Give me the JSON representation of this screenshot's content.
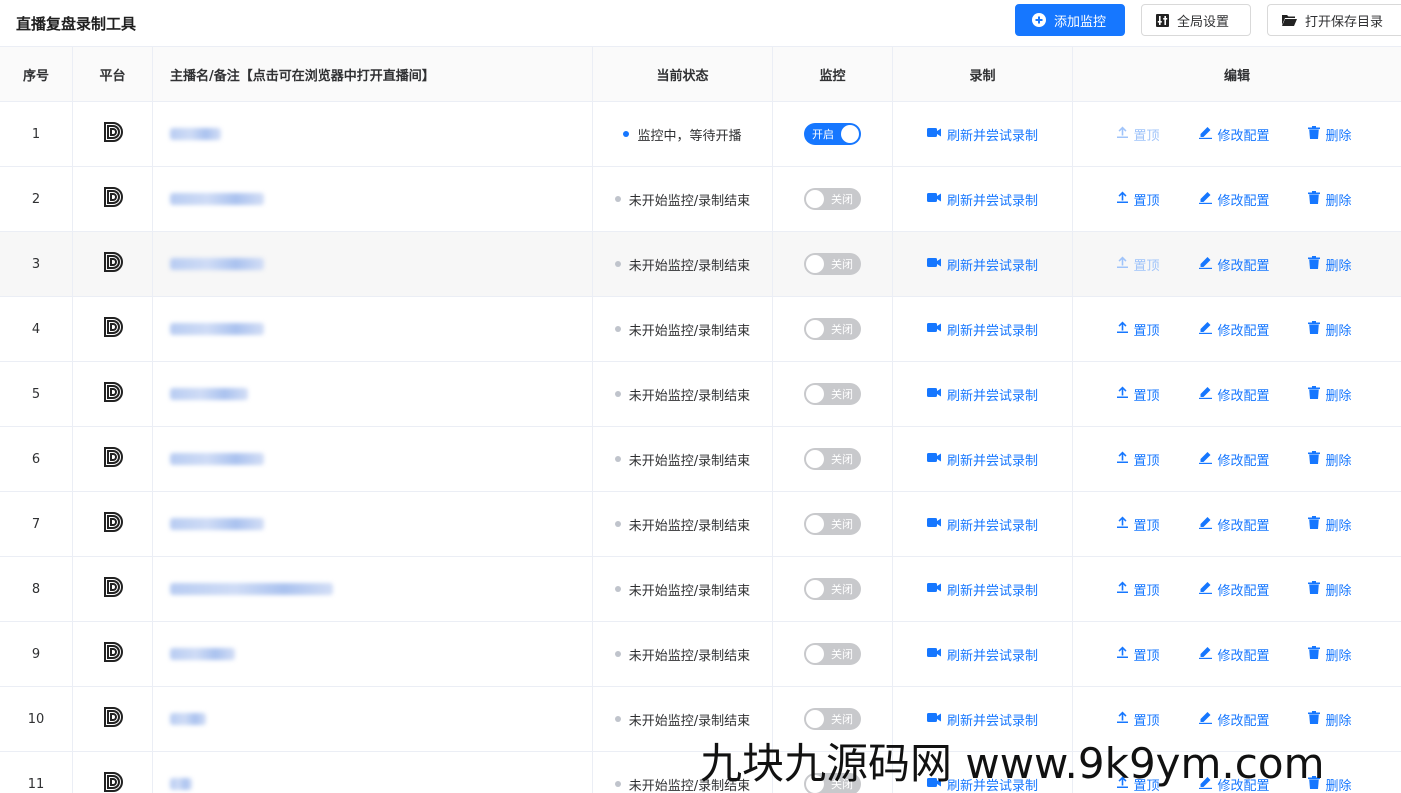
{
  "app": {
    "title": "直播复盘录制工具"
  },
  "toolbar": {
    "add_label": "添加监控",
    "global_label": "全局设置",
    "open_dir_label": "打开保存目录"
  },
  "table": {
    "headers": {
      "index": "序号",
      "platform": "平台",
      "name": "主播名/备注【点击可在浏览器中打开直播间】",
      "status": "当前状态",
      "monitor": "监控",
      "record": "录制",
      "edit": "编辑"
    },
    "rows": [
      {
        "index": "1",
        "platform_icon": "douyin-logo-icon",
        "status": "监控中，等待开播",
        "status_active": true,
        "monitor": "开启",
        "monitor_on": true,
        "record": "刷新并尝试录制",
        "pin": "置顶",
        "pin_disabled": true,
        "config": "修改配置",
        "delete": "删除",
        "name_fill": 0.3
      },
      {
        "index": "2",
        "platform_icon": "douyin-logo-icon",
        "status": "未开始监控/录制结束",
        "status_active": false,
        "monitor": "关闭",
        "monitor_on": false,
        "record": "刷新并尝试录制",
        "pin": "置顶",
        "pin_disabled": false,
        "config": "修改配置",
        "delete": "删除",
        "name_fill": 0.55
      },
      {
        "index": "3",
        "platform_icon": "douyin-logo-icon",
        "status": "未开始监控/录制结束",
        "status_active": false,
        "monitor": "关闭",
        "monitor_on": false,
        "record": "刷新并尝试录制",
        "pin": "置顶",
        "pin_disabled": true,
        "config": "修改配置",
        "delete": "删除",
        "name_fill": 0.55
      },
      {
        "index": "4",
        "platform_icon": "douyin-logo-icon",
        "status": "未开始监控/录制结束",
        "status_active": false,
        "monitor": "关闭",
        "monitor_on": false,
        "record": "刷新并尝试录制",
        "pin": "置顶",
        "pin_disabled": false,
        "config": "修改配置",
        "delete": "删除",
        "name_fill": 0.55
      },
      {
        "index": "5",
        "platform_icon": "douyin-logo-icon",
        "status": "未开始监控/录制结束",
        "status_active": false,
        "monitor": "关闭",
        "monitor_on": false,
        "record": "刷新并尝试录制",
        "pin": "置顶",
        "pin_disabled": false,
        "config": "修改配置",
        "delete": "删除",
        "name_fill": 0.46
      },
      {
        "index": "6",
        "platform_icon": "douyin-logo-icon",
        "status": "未开始监控/录制结束",
        "status_active": false,
        "monitor": "关闭",
        "monitor_on": false,
        "record": "刷新并尝试录制",
        "pin": "置顶",
        "pin_disabled": false,
        "config": "修改配置",
        "delete": "删除",
        "name_fill": 0.55
      },
      {
        "index": "7",
        "platform_icon": "douyin-logo-icon",
        "status": "未开始监控/录制结束",
        "status_active": false,
        "monitor": "关闭",
        "monitor_on": false,
        "record": "刷新并尝试录制",
        "pin": "置顶",
        "pin_disabled": false,
        "config": "修改配置",
        "delete": "删除",
        "name_fill": 0.55
      },
      {
        "index": "8",
        "platform_icon": "douyin-logo-icon",
        "status": "未开始监控/录制结束",
        "status_active": false,
        "monitor": "关闭",
        "monitor_on": false,
        "record": "刷新并尝试录制",
        "pin": "置顶",
        "pin_disabled": false,
        "config": "修改配置",
        "delete": "删除",
        "name_fill": 0.96
      },
      {
        "index": "9",
        "platform_icon": "douyin-logo-icon",
        "status": "未开始监控/录制结束",
        "status_active": false,
        "monitor": "关闭",
        "monitor_on": false,
        "record": "刷新并尝试录制",
        "pin": "置顶",
        "pin_disabled": false,
        "config": "修改配置",
        "delete": "删除",
        "name_fill": 0.38
      },
      {
        "index": "10",
        "platform_icon": "douyin-logo-icon",
        "status": "未开始监控/录制结束",
        "status_active": false,
        "monitor": "关闭",
        "monitor_on": false,
        "record": "刷新并尝试录制",
        "pin": "置顶",
        "pin_disabled": false,
        "config": "修改配置",
        "delete": "删除",
        "name_fill": 0.21
      },
      {
        "index": "11",
        "platform_icon": "douyin-logo-icon",
        "status": "未开始监控/录制结束",
        "status_active": false,
        "monitor": "关闭",
        "monitor_on": false,
        "record": "刷新并尝试录制",
        "pin": "置顶",
        "pin_disabled": false,
        "config": "修改配置",
        "delete": "删除",
        "name_fill": 0.13
      }
    ]
  },
  "watermark": "九块九源码网 www.9k9ym.com",
  "colors": {
    "accent": "#1677ff",
    "accent_disabled": "#a0c4fa",
    "switch_off": "#c8c9cc"
  }
}
